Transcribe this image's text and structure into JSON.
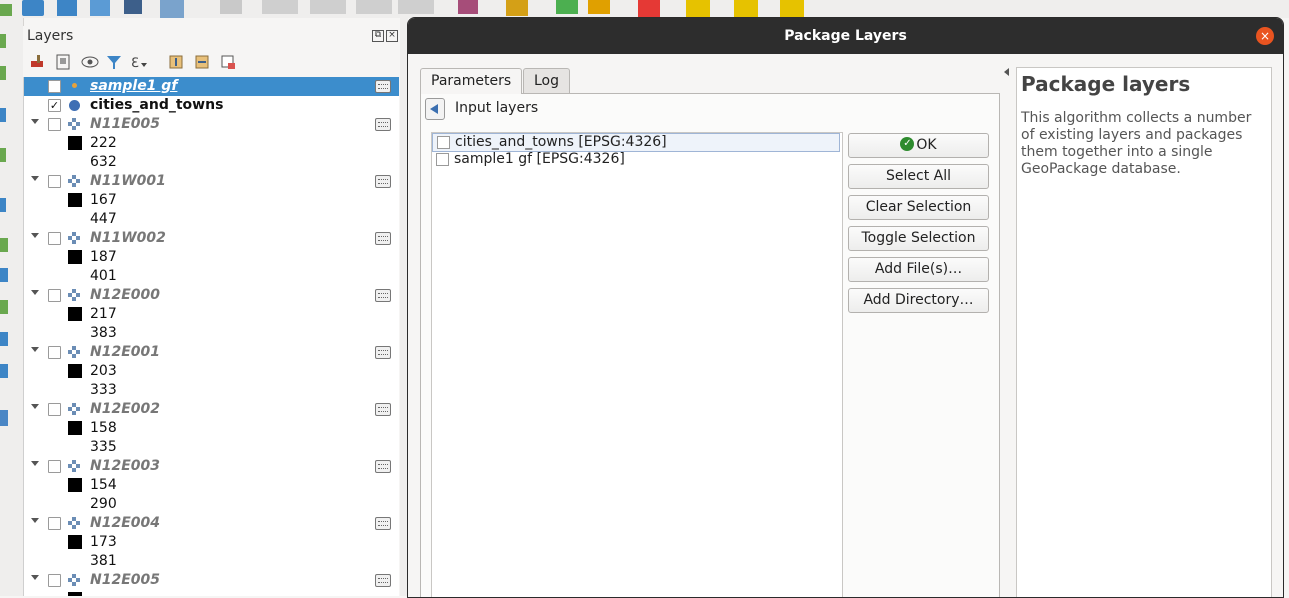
{
  "layers_panel": {
    "title": "Layers",
    "dock_float_glyph": "⧉",
    "dock_close_glyph": "×",
    "toolbar_icons": [
      "style-manager-icon",
      "add-group-icon",
      "filter-legend-icon",
      "filter-expression-icon",
      "expand-all-icon",
      "collapse-all-icon",
      "remove-layer-icon"
    ],
    "layers": [
      {
        "name": "sample1 gf",
        "checked": false,
        "selected": true,
        "kind": "point",
        "expandable": false
      },
      {
        "name": "cities_and_towns",
        "checked": true,
        "selected": false,
        "kind": "polygon",
        "expandable": false
      },
      {
        "name": "N11E005",
        "checked": false,
        "kind": "raster",
        "expandable": true,
        "values": [
          "222",
          "632"
        ]
      },
      {
        "name": "N11W001",
        "checked": false,
        "kind": "raster",
        "expandable": true,
        "values": [
          "167",
          "447"
        ]
      },
      {
        "name": "N11W002",
        "checked": false,
        "kind": "raster",
        "expandable": true,
        "values": [
          "187",
          "401"
        ]
      },
      {
        "name": "N12E000",
        "checked": false,
        "kind": "raster",
        "expandable": true,
        "values": [
          "217",
          "383"
        ]
      },
      {
        "name": "N12E001",
        "checked": false,
        "kind": "raster",
        "expandable": true,
        "values": [
          "203",
          "333"
        ]
      },
      {
        "name": "N12E002",
        "checked": false,
        "kind": "raster",
        "expandable": true,
        "values": [
          "158",
          "335"
        ]
      },
      {
        "name": "N12E003",
        "checked": false,
        "kind": "raster",
        "expandable": true,
        "values": [
          "154",
          "290"
        ]
      },
      {
        "name": "N12E004",
        "checked": false,
        "kind": "raster",
        "expandable": true,
        "values": [
          "173",
          "381"
        ]
      },
      {
        "name": "N12E005",
        "checked": false,
        "kind": "raster",
        "expandable": true,
        "values": []
      }
    ],
    "check_glyph": "✓"
  },
  "dialog": {
    "title": "Package Layers",
    "close_glyph": "×",
    "tabs": [
      {
        "label": "Parameters",
        "active": true
      },
      {
        "label": "Log",
        "active": false
      }
    ],
    "input_layers_title": "Input layers",
    "input_items": [
      {
        "label": "cities_and_towns [EPSG:4326]",
        "checked": false,
        "current": true
      },
      {
        "label": "sample1 gf [EPSG:4326]",
        "checked": false,
        "current": false
      }
    ],
    "buttons": {
      "ok": "OK",
      "ok_icon_glyph": "✓",
      "select_all": "Select All",
      "clear_selection": "Clear Selection",
      "toggle_selection": "Toggle Selection",
      "add_files": "Add File(s)…",
      "add_directory": "Add Directory…"
    },
    "help": {
      "title": "Package layers",
      "text": "This algorithm collects a number of existing layers and packages them together into a single GeoPackage database."
    }
  },
  "colors": {
    "selection": "#3c8dcc",
    "titlebar": "#2d2d2d",
    "close_button": "#e95420",
    "ok_icon": "#2e8b2e"
  }
}
